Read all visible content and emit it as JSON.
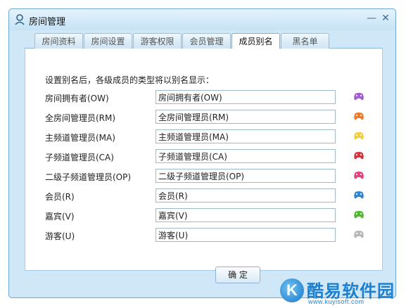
{
  "window": {
    "title": "房间管理",
    "minimize": "—",
    "close": "✕"
  },
  "tabs": [
    {
      "label": "房间资料",
      "active": false
    },
    {
      "label": "房间设置",
      "active": false
    },
    {
      "label": "游客权限",
      "active": false
    },
    {
      "label": "会员管理",
      "active": false
    },
    {
      "label": "成员别名",
      "active": true
    },
    {
      "label": "黑名单",
      "active": false
    }
  ],
  "panel": {
    "description": "设置别名后，各级成员的类型将以别名显示：",
    "rows": [
      {
        "label": "房间拥有者(OW)",
        "value": "房间拥有者(OW)",
        "icon": "gamepad-purple-icon",
        "color": "#a45bd6"
      },
      {
        "label": "全房间管理员(RM)",
        "value": "全房间管理员(RM)",
        "icon": "gamepad-orange-icon",
        "color": "#f07a26"
      },
      {
        "label": "主频道管理员(MA)",
        "value": "主频道管理员(MA)",
        "icon": "gamepad-yellow-icon",
        "color": "#f2cf3a"
      },
      {
        "label": "子频道管理员(CA)",
        "value": "子频道管理员(CA)",
        "icon": "gamepad-red-icon",
        "color": "#d9353a"
      },
      {
        "label": "二级子频道管理员(OP)",
        "value": "二级子频道管理员(OP)",
        "icon": "gamepad-pink-icon",
        "color": "#e6407e"
      },
      {
        "label": "会员(R)",
        "value": "会员(R)",
        "icon": "gamepad-blue-icon",
        "color": "#2f86d6"
      },
      {
        "label": "嘉宾(V)",
        "value": "嘉宾(V)",
        "icon": "gamepad-green-icon",
        "color": "#4dbb2c"
      },
      {
        "label": "游客(U)",
        "value": "游客(U)",
        "icon": "gamepad-gray-icon",
        "color": "#b8b8b8"
      }
    ]
  },
  "footer": {
    "ok_label": "确 定"
  },
  "watermark": {
    "letter": "K",
    "text": "酷易软件园",
    "url": "www.kuyisoft.com"
  }
}
